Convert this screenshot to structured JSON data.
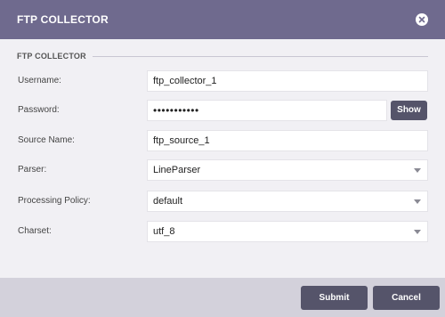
{
  "dialog": {
    "title": "FTP COLLECTOR",
    "close_icon": "close-icon"
  },
  "section": {
    "title": "FTP COLLECTOR"
  },
  "fields": {
    "username": {
      "label": "Username:",
      "value": "ftp_collector_1"
    },
    "password": {
      "label": "Password:",
      "value": "•••••••••••",
      "show_label": "Show"
    },
    "source_name": {
      "label": "Source Name:",
      "value": "ftp_source_1"
    },
    "parser": {
      "label": "Parser:",
      "value": "LineParser"
    },
    "processing_policy": {
      "label": "Processing Policy:",
      "value": "default"
    },
    "charset": {
      "label": "Charset:",
      "value": "utf_8"
    }
  },
  "footer": {
    "submit_label": "Submit",
    "cancel_label": "Cancel"
  },
  "colors": {
    "header_bg": "#6f6a8e",
    "button_bg": "#55546a",
    "body_bg": "#f1f0f4",
    "footer_bg": "#d3d1db"
  }
}
